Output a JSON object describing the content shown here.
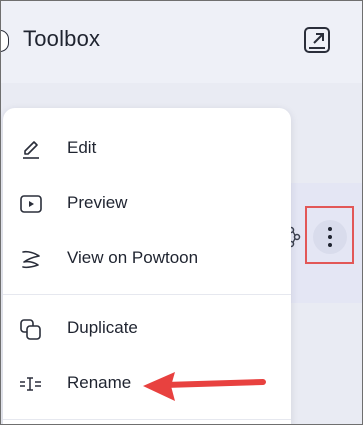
{
  "header": {
    "title": "Toolbox"
  },
  "menu": {
    "items": [
      {
        "label": "Edit",
        "icon": "pencil-icon"
      },
      {
        "label": "Preview",
        "icon": "play-icon"
      },
      {
        "label": "View on Powtoon",
        "icon": "powtoon-logo-icon"
      },
      {
        "label": "Duplicate",
        "icon": "duplicate-icon"
      },
      {
        "label": "Rename",
        "icon": "rename-icon"
      }
    ]
  },
  "annotation": {
    "highlight_color": "#e25757",
    "arrow_color": "#e8413f"
  }
}
